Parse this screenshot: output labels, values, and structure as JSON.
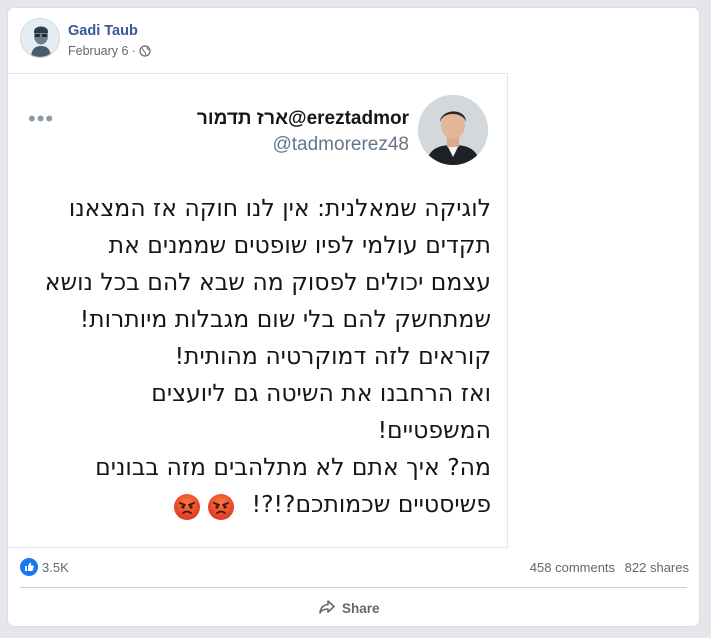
{
  "post": {
    "author": "Gadi Taub",
    "date": "February 6",
    "separator": "·",
    "privacy_icon": "globe-icon"
  },
  "tweet": {
    "display_name": "ארז תדמור@ereztadmor",
    "handle": "@tadmorerez48",
    "lines": [
      "לוגיקה שמאלנית: אין לנו חוקה אז המצאנו",
      "תקדים עולמי לפיו שופטים שממנים את",
      "עצמם יכולים לפסוק מה שבא להם בכל נושא",
      "שמתחשק להם בלי שום מגבלות מיותרות!",
      "קוראים לזה דמוקרטיה מהותית!",
      "ואז הרחבנו את השיטה גם ליועצים",
      "המשפטיים!",
      "מה? איך אתם לא מתלהבים מזה בבונים"
    ],
    "last_line": "פשיסטיים שכמותכם?!?!",
    "emoji": [
      "angry-face-emoji",
      "angry-face-emoji"
    ],
    "more_icon": "more-dots-icon"
  },
  "stats": {
    "reactions": "3.5K",
    "comments": "458 comments",
    "shares": "822 shares"
  },
  "actions": {
    "share_label": "Share"
  },
  "colors": {
    "author_link": "#385898",
    "like_blue": "#1877f2",
    "muted_text": "#65676b"
  }
}
